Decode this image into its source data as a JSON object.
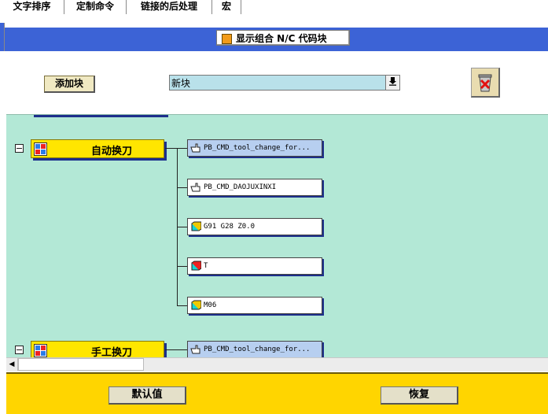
{
  "tabs": [
    "文字排序",
    "定制命令",
    "链接的后处理",
    "宏"
  ],
  "toggle_label": "显示组合 N/C 代码块",
  "add_block_label": "添加块",
  "block_select_value": "新块",
  "groups": [
    {
      "label": "自动换刀",
      "commands": [
        "PB_CMD_tool_change_for...",
        "PB_CMD_DAOJUXINXI",
        "G91  G28  Z0.0",
        "T",
        "M06"
      ]
    },
    {
      "label": "手工换刀",
      "commands": [
        "PB_CMD_tool_change_for..."
      ]
    }
  ],
  "default_button": "默认值",
  "restore_button": "恢复",
  "colors": {
    "header_blue": "#3c63d6",
    "canvas_green": "#b3e8d6",
    "group_yellow": "#ffe600",
    "bottom_yellow": "#ffd500"
  }
}
